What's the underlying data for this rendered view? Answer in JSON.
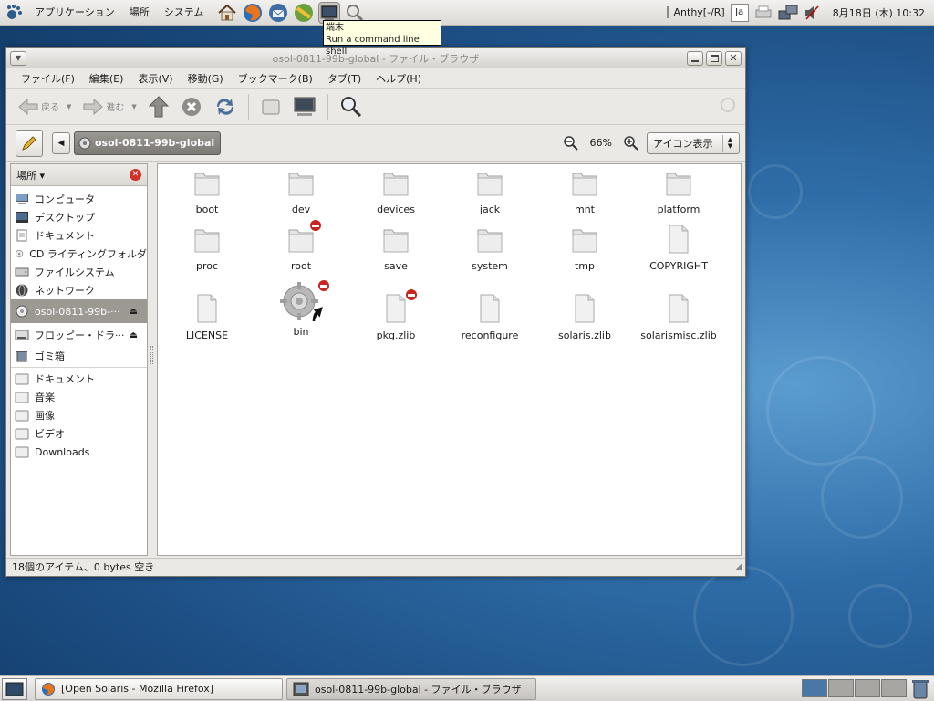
{
  "top_panel": {
    "menus": [
      "アプリケーション",
      "場所",
      "システム"
    ],
    "ime_status": "Anthy[-/R]",
    "ime_lang": "Ja",
    "clock": "8月18日 (木) 10:32"
  },
  "tooltip": {
    "title": "端末",
    "description": "Run a command line shell"
  },
  "window": {
    "title": "osol-0811-99b-global - ファイル・ブラウザ",
    "menubar": [
      "ファイル(F)",
      "編集(E)",
      "表示(V)",
      "移動(G)",
      "ブックマーク(B)",
      "タブ(T)",
      "ヘルプ(H)"
    ],
    "toolbar": {
      "back_label": "戻る",
      "forward_label": "進む"
    },
    "location": {
      "path": "osol-0811-99b-global",
      "zoom": "66%",
      "view_mode": "アイコン表示"
    },
    "sidebar": {
      "header": "場所 ▾",
      "places": [
        {
          "label": "コンピュータ",
          "icon": "computer-icon"
        },
        {
          "label": "デスクトップ",
          "icon": "desktop-icon"
        },
        {
          "label": "ドキュメント",
          "icon": "document-icon"
        },
        {
          "label": "CD ライティングフォルダ",
          "icon": "cd-icon"
        },
        {
          "label": "ファイルシステム",
          "icon": "drive-icon"
        },
        {
          "label": "ネットワーク",
          "icon": "network-icon"
        },
        {
          "label": "osol-0811-99b-···",
          "icon": "disc-icon",
          "selected": true,
          "eject": true
        },
        {
          "label": "フロッピー・ドラ···",
          "icon": "floppy-icon",
          "eject": true
        },
        {
          "label": "ゴミ箱",
          "icon": "trash-icon"
        }
      ],
      "bookmarks": [
        {
          "label": "ドキュメント"
        },
        {
          "label": "音楽"
        },
        {
          "label": "画像"
        },
        {
          "label": "ビデオ"
        },
        {
          "label": "Downloads"
        }
      ]
    },
    "files": [
      {
        "name": "boot",
        "type": "folder"
      },
      {
        "name": "dev",
        "type": "folder"
      },
      {
        "name": "devices",
        "type": "folder"
      },
      {
        "name": "jack",
        "type": "folder"
      },
      {
        "name": "mnt",
        "type": "folder"
      },
      {
        "name": "platform",
        "type": "folder"
      },
      {
        "name": "proc",
        "type": "folder"
      },
      {
        "name": "root",
        "type": "folder",
        "locked": true
      },
      {
        "name": "save",
        "type": "folder"
      },
      {
        "name": "system",
        "type": "folder"
      },
      {
        "name": "tmp",
        "type": "folder"
      },
      {
        "name": "COPYRIGHT",
        "type": "file"
      },
      {
        "name": "LICENSE",
        "type": "file"
      },
      {
        "name": "bin",
        "type": "executable",
        "locked": true
      },
      {
        "name": "pkg.zlib",
        "type": "file",
        "locked": true
      },
      {
        "name": "reconfigure",
        "type": "file"
      },
      {
        "name": "solaris.zlib",
        "type": "file"
      },
      {
        "name": "solarismisc.zlib",
        "type": "file"
      }
    ],
    "status": "18個のアイテム、0 bytes 空き"
  },
  "bottom_panel": {
    "tasks": [
      {
        "label": "[Open Solaris - Mozilla Firefox]",
        "icon": "firefox-icon"
      },
      {
        "label": "osol-0811-99b-global - ファイル・ブラウザ",
        "icon": "file-browser-icon"
      }
    ]
  }
}
